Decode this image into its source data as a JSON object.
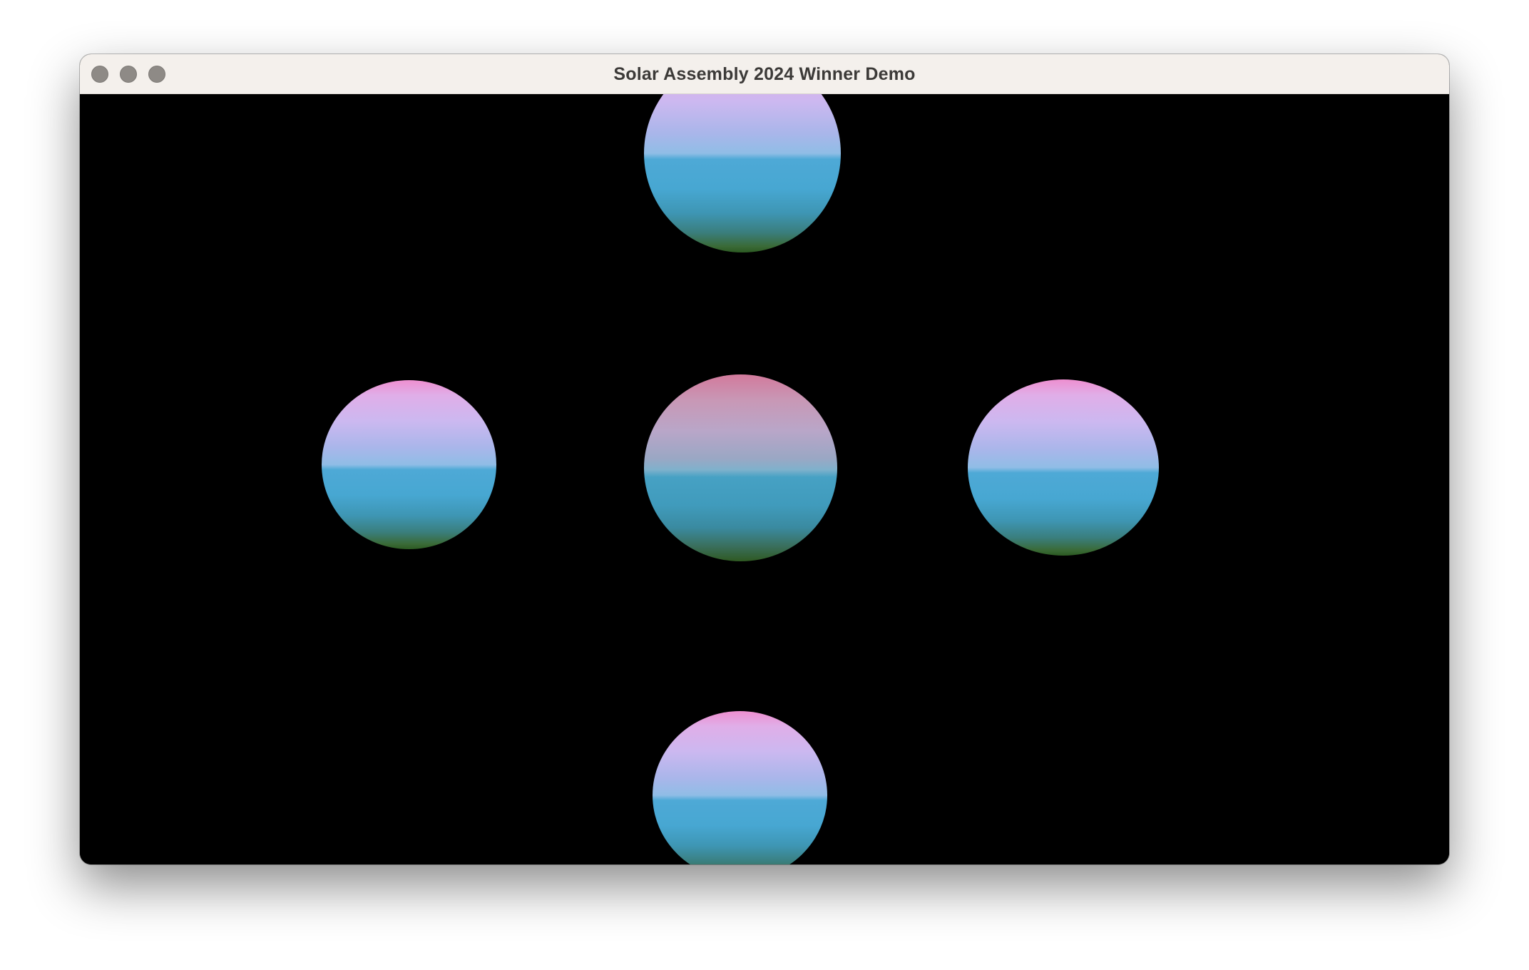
{
  "window": {
    "title": "Solar Assembly 2024 Winner Demo",
    "controls": [
      "close-button",
      "minimize-button",
      "zoom-button"
    ],
    "control_color": "#8e8a86",
    "titlebar_color": "#f4f0ec"
  },
  "scene": {
    "background_color": "#000000",
    "spheres": [
      {
        "name": "sphere-top",
        "colors": [
          "#ee8fd0",
          "#ccb8f0",
          "#4ea9d6",
          "#2c5a22"
        ]
      },
      {
        "name": "sphere-left",
        "colors": [
          "#ee8fd0",
          "#ccb8f0",
          "#4ea9d6",
          "#2c5a22"
        ]
      },
      {
        "name": "sphere-center",
        "colors": [
          "#d27a9c",
          "#b9a6c8",
          "#46a1c4",
          "#2f5a22"
        ]
      },
      {
        "name": "sphere-right",
        "colors": [
          "#ee8fd0",
          "#ccb8f0",
          "#4ea9d6",
          "#2c5a22"
        ]
      },
      {
        "name": "sphere-bottom",
        "colors": [
          "#ee8fd0",
          "#ccb8f0",
          "#4ea9d6",
          "#2c5a22"
        ]
      }
    ]
  }
}
